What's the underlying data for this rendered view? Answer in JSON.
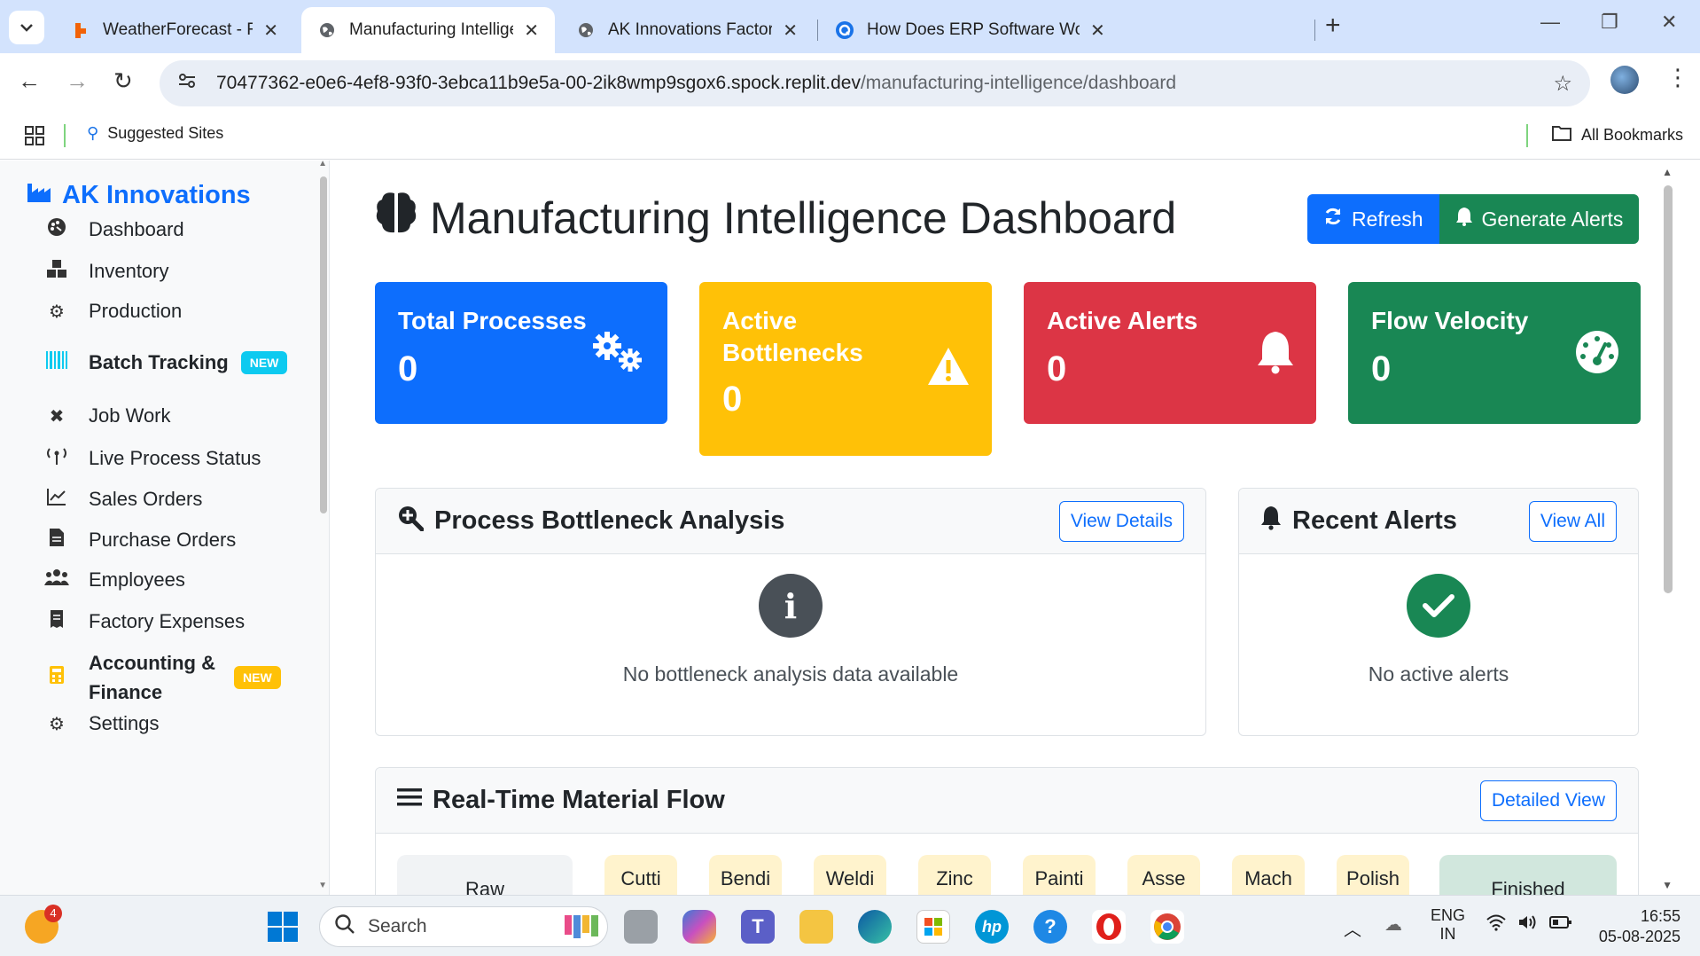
{
  "browser": {
    "tabs": [
      {
        "title": "WeatherForecast - Replit",
        "favicon": "replit-icon",
        "active": false
      },
      {
        "title": "Manufacturing Intelligence Dasl",
        "favicon": "globe-icon",
        "active": true
      },
      {
        "title": "AK Innovations Factory Manage",
        "favicon": "globe-icon",
        "active": false
      },
      {
        "title": "How Does ERP Software Work: S",
        "favicon": "question-icon",
        "active": false
      }
    ],
    "url_host": "70477362-e0e6-4ef8-93f0-3ebca11b9e5a-00-2ik8wmp9sgox6.spock.replit.dev",
    "url_path": "/manufacturing-intelligence/dashboard",
    "bookmarks": {
      "suggested": "Suggested Sites",
      "all": "All Bookmarks"
    }
  },
  "sidebar": {
    "brand": "AK Innovations",
    "items": [
      {
        "label": "Dashboard",
        "icon": "palette-icon"
      },
      {
        "label": "Inventory",
        "icon": "boxes-icon"
      },
      {
        "label": "Production",
        "icon": "cogs-icon"
      },
      {
        "label": "Batch Tracking",
        "icon": "barcode-icon",
        "badge": "NEW"
      },
      {
        "label": "Job Work",
        "icon": "tools-icon"
      },
      {
        "label": "Live Process Status",
        "icon": "broadcast-icon"
      },
      {
        "label": "Sales Orders",
        "icon": "chart-line-icon"
      },
      {
        "label": "Purchase Orders",
        "icon": "file-icon"
      },
      {
        "label": "Employees",
        "icon": "users-icon"
      },
      {
        "label": "Factory Expenses",
        "icon": "receipt-icon"
      },
      {
        "label": "Accounting &",
        "label2": "Finance",
        "icon": "calculator-icon",
        "badge": "NEW"
      },
      {
        "label": "Settings",
        "icon": "gear-icon"
      }
    ]
  },
  "main": {
    "title": "Manufacturing Intelligence Dashboard",
    "refresh_label": "Refresh",
    "alerts_label": "Generate Alerts",
    "stats": [
      {
        "label": "Total Processes",
        "value": "0",
        "color": "#0d6efd"
      },
      {
        "label": "Active Bottlenecks",
        "value": "0",
        "color": "#ffc107"
      },
      {
        "label": "Active Alerts",
        "value": "0",
        "color": "#dc3545"
      },
      {
        "label": "Flow Velocity",
        "value": "0",
        "color": "#198754"
      }
    ],
    "bottleneck": {
      "title": "Process Bottleneck Analysis",
      "button": "View Details",
      "empty": "No bottleneck analysis data available"
    },
    "alerts": {
      "title": "Recent Alerts",
      "button": "View All",
      "empty": "No active alerts"
    },
    "flow": {
      "title": "Real-Time Material Flow",
      "button": "Detailed View",
      "stages": [
        "Raw",
        "Cutti",
        "Bendi",
        "Weldi",
        "Zinc",
        "Painti",
        "Asse",
        "Mach",
        "Polish",
        "Finished"
      ]
    }
  },
  "taskbar": {
    "search": "Search",
    "lang1": "ENG",
    "lang2": "IN",
    "time": "16:55",
    "date": "05-08-2025",
    "notif_count": "4"
  }
}
